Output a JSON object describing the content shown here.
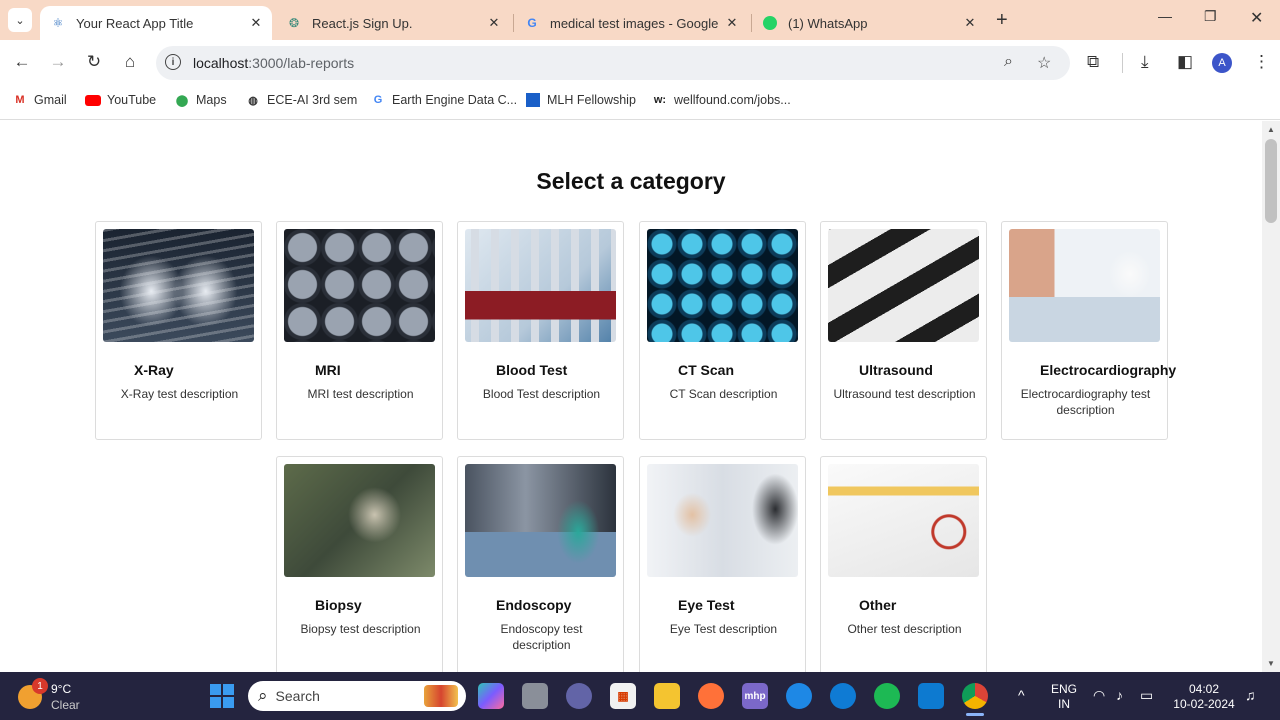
{
  "browser": {
    "tabs": [
      {
        "title": "Your React App Title",
        "active": true
      },
      {
        "title": "React.js Sign Up.",
        "active": false
      },
      {
        "title": "medical test images - Google S",
        "active": false
      },
      {
        "title": "(1) WhatsApp",
        "active": false
      }
    ],
    "url_host": "localhost",
    "url_path": ":3000/lab-reports",
    "profile_initial": "A",
    "bookmarks": [
      "Gmail",
      "YouTube",
      "Maps",
      "ECE-AI 3rd sem",
      "Earth Engine Data C...",
      "MLH Fellowship",
      "wellfound.com/jobs..."
    ]
  },
  "page": {
    "heading": "Select a category",
    "categories": [
      {
        "name": "X-Ray",
        "description": "X-Ray test description"
      },
      {
        "name": "MRI",
        "description": "MRI test description"
      },
      {
        "name": "Blood Test",
        "description": "Blood Test description"
      },
      {
        "name": "CT Scan",
        "description": "CT Scan description"
      },
      {
        "name": "Ultrasound",
        "description": "Ultrasound test description"
      },
      {
        "name": "Electrocardiography",
        "description": "Electrocardiography test description"
      },
      {
        "name": "Biopsy",
        "description": "Biopsy test description"
      },
      {
        "name": "Endoscopy",
        "description": "Endoscopy test description"
      },
      {
        "name": "Eye Test",
        "description": "Eye Test description"
      },
      {
        "name": "Other",
        "description": "Other test description"
      }
    ]
  },
  "taskbar": {
    "weather_temp": "9°C",
    "weather_cond": "Clear",
    "weather_badge": "1",
    "search_placeholder": "Search",
    "lang_line1": "ENG",
    "lang_line2": "IN",
    "time": "04:02",
    "date": "10-02-2024"
  },
  "colors": {
    "tabbar": "#f8d9c6",
    "taskbar": "#24243f",
    "accent": "#3c55c9"
  }
}
